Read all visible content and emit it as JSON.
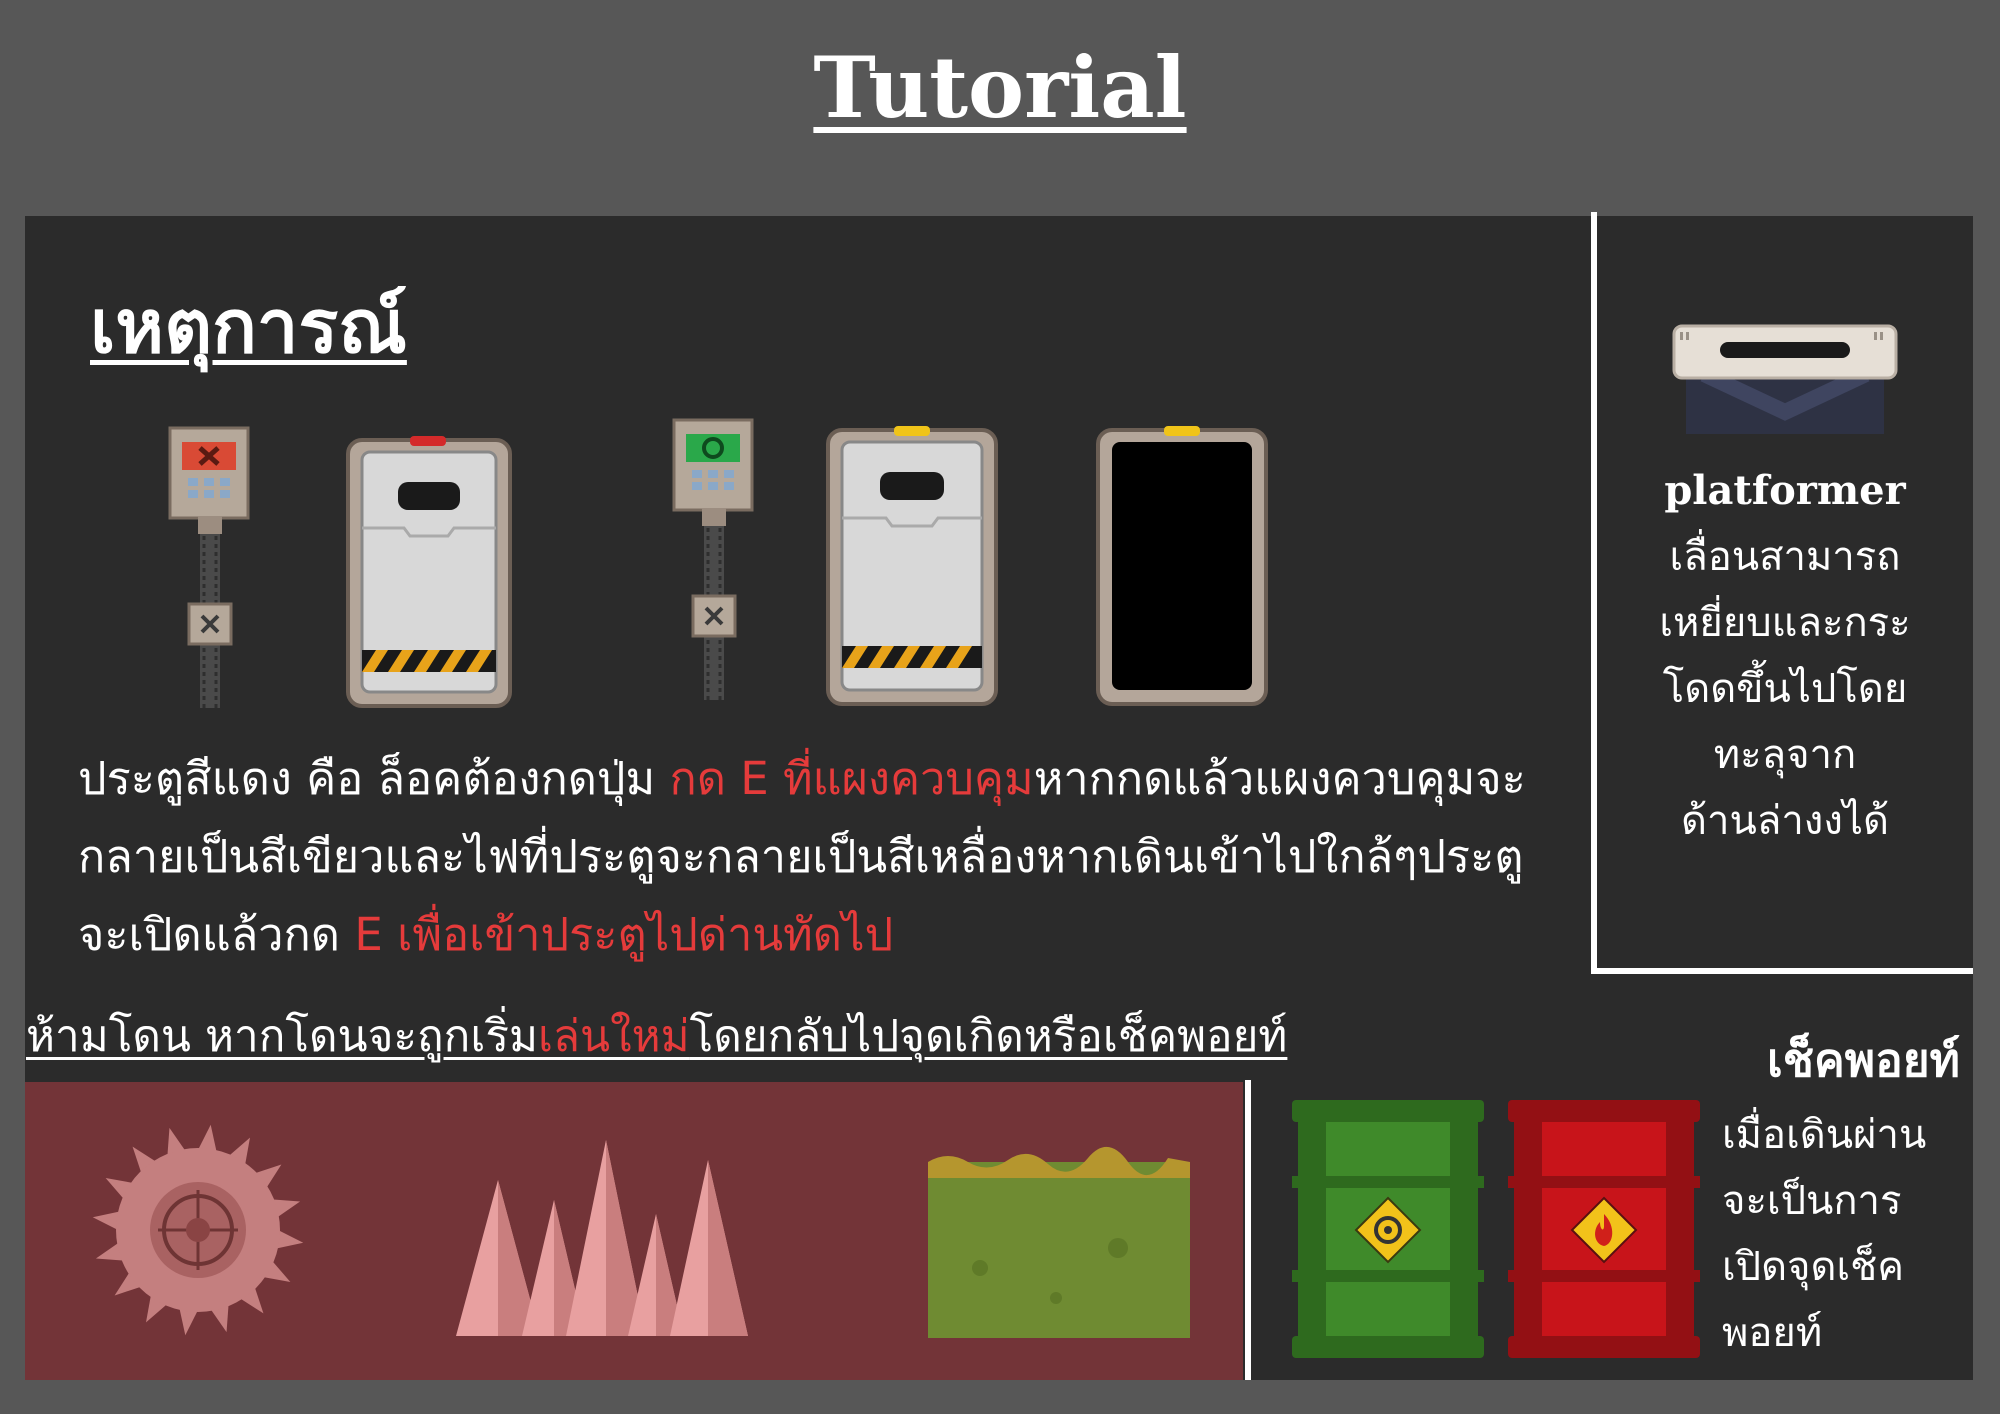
{
  "title": "Tutorial",
  "event": {
    "heading": "เหตุการณ์",
    "description": {
      "part1": "ประตูสีแดง คือ ล็อคต้องกดปุ่ม ",
      "part2_red": "กด E ที่แผงควบคุม",
      "part3": "หากกดแล้วแผงควบคุมจะกลายเป็นสีเขียวและไฟที่ประตูจะกลายเป็นสีเหลื่องหากเดินเข้าไปใกล้ๆประตูจะเปิดแล้วกด ",
      "part4_red": "E เพื่อเข้าประตูไปด่านทัดไป"
    }
  },
  "hazards": {
    "caption_part1": "ห้ามโดน หากโดนจะถูกเริ่ม",
    "caption_part2_red": "เล่นใหม่",
    "caption_part3": "โดยกลับไปจุดเกิดหรือเช็คพอยท์"
  },
  "platformer": {
    "title": "platformer",
    "lines": [
      "เลื่อนสามารถ",
      "เหยี่ยบและกระ",
      "โดดขึ้นไปโดย",
      "ทะลุจาก",
      "ด้านล่างงได้"
    ]
  },
  "checkpoint": {
    "title": "เช็คพอยท์",
    "lines": [
      "เมื่อเดินผ่าน",
      "จะเป็นการ",
      "เปิดจุดเช็ค",
      "พอยท์"
    ]
  },
  "colors": {
    "background": "#575757",
    "panel": "#2b2b2b",
    "hazard_panel": "#733438",
    "accent_red": "#e53b3b"
  }
}
